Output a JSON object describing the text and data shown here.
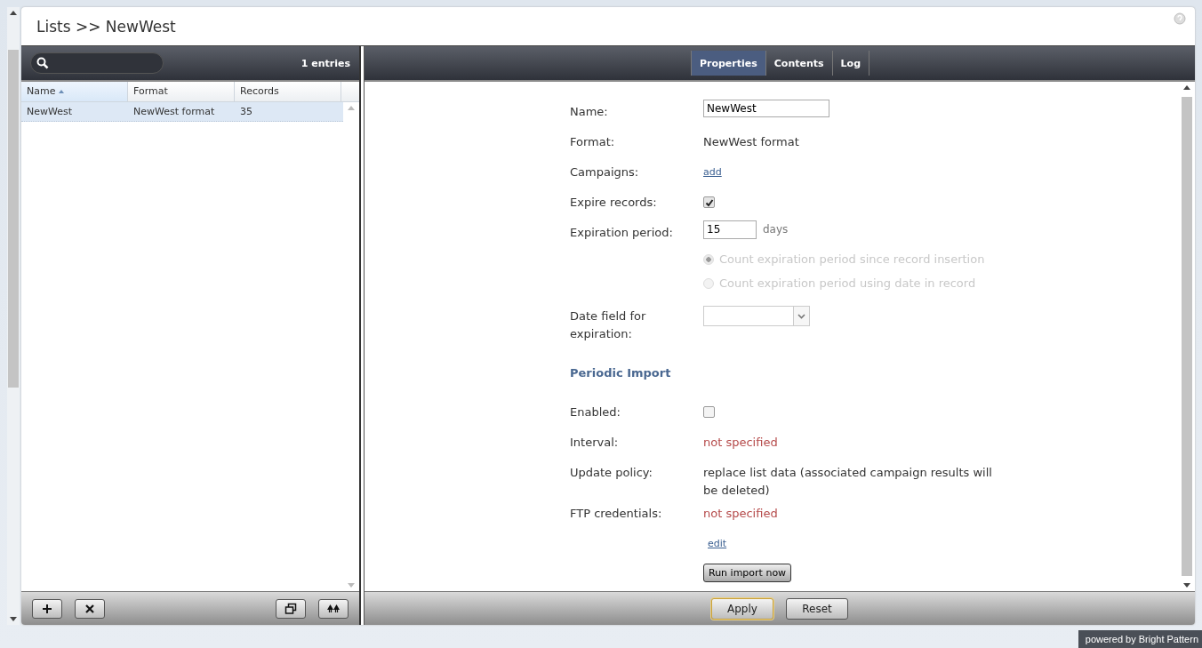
{
  "window": {
    "title": "Lists >> NewWest"
  },
  "list_panel": {
    "entry_count": "1 entries",
    "columns": [
      {
        "label": "Name",
        "sorted": true
      },
      {
        "label": "Format",
        "sorted": false
      },
      {
        "label": "Records",
        "sorted": false
      }
    ],
    "rows": [
      {
        "cells": [
          "NewWest",
          "NewWest format",
          "35"
        ],
        "selected": true
      }
    ],
    "footer_buttons": [
      {
        "kind": "add"
      },
      {
        "kind": "delete"
      },
      {
        "kind": "copy"
      },
      {
        "kind": "import"
      }
    ]
  },
  "tabs": [
    {
      "label": "Properties",
      "selected": true
    },
    {
      "label": "Contents",
      "selected": false
    },
    {
      "label": "Log",
      "selected": false
    }
  ],
  "form": [
    {
      "kind": "input",
      "label": "Name:",
      "value": "NewWest"
    },
    {
      "kind": "text",
      "label": "Format:",
      "value": "NewWest format",
      "warning": false
    },
    {
      "kind": "link",
      "label": "Campaigns:",
      "value": "add"
    },
    {
      "kind": "checkbox",
      "label": "Expire records:",
      "checked": true
    },
    {
      "kind": "input_unit",
      "label": "Expiration period:",
      "value": "15",
      "unit": "days"
    },
    {
      "kind": "radio",
      "label": "Count expiration period since record insertion",
      "selected": true,
      "disabled": true
    },
    {
      "kind": "radio",
      "label": "Count expiration period using date in record",
      "selected": false,
      "disabled": true
    },
    {
      "kind": "select",
      "label": "Date field for expiration:"
    },
    {
      "kind": "heading",
      "label": "Periodic Import"
    },
    {
      "kind": "checkbox",
      "label": "Enabled:",
      "checked": false
    },
    {
      "kind": "text",
      "label": "Interval:",
      "value": "not specified",
      "warning": true
    },
    {
      "kind": "text",
      "label": "Update policy:",
      "value": "replace list data (associated campaign results will be deleted)",
      "warning": false
    },
    {
      "kind": "text",
      "label": "FTP credentials:",
      "value": "not specified",
      "warning": true
    },
    {
      "kind": "link",
      "value": "edit"
    },
    {
      "kind": "button",
      "value": "Run import now"
    }
  ],
  "footer_buttons": [
    {
      "label": "Apply",
      "focused": true
    },
    {
      "label": "Reset",
      "focused": false
    }
  ],
  "badge": "powered by Bright Pattern"
}
